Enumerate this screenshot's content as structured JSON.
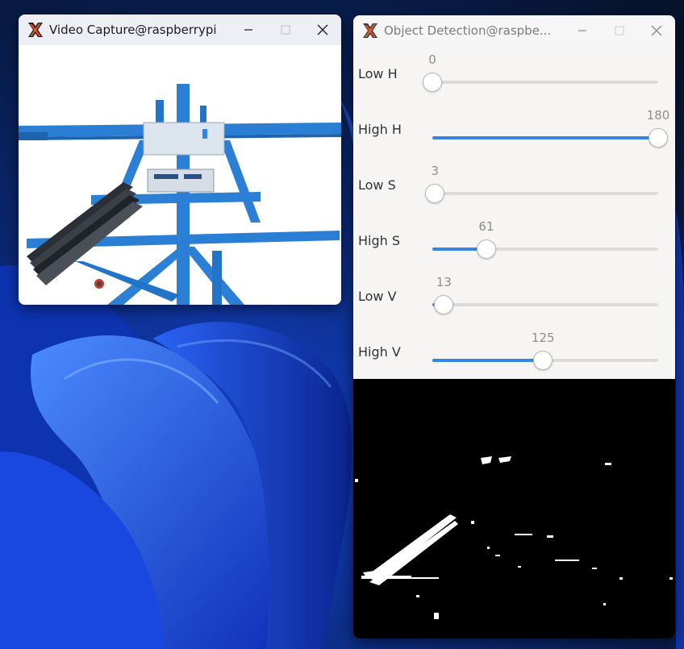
{
  "windows": {
    "capture": {
      "title": "Video Capture@raspberrypi",
      "minimize_icon": "minimize-icon",
      "maximize_icon": "maximize-icon",
      "close_icon": "close-icon"
    },
    "detection": {
      "title": "Object Detection@raspbe...",
      "minimize_icon": "minimize-icon",
      "maximize_icon": "maximize-icon",
      "close_icon": "close-icon"
    }
  },
  "trackbars": [
    {
      "label": "Low H",
      "value": "0",
      "min": 0,
      "max": 180,
      "current": 0
    },
    {
      "label": "High H",
      "value": "180",
      "min": 0,
      "max": 180,
      "current": 180
    },
    {
      "label": "Low S",
      "value": "3",
      "min": 0,
      "max": 255,
      "current": 3
    },
    {
      "label": "High S",
      "value": "61",
      "min": 0,
      "max": 255,
      "current": 61
    },
    {
      "label": "Low V",
      "value": "13",
      "min": 0,
      "max": 255,
      "current": 13
    },
    {
      "label": "High V",
      "value": "125",
      "min": 0,
      "max": 255,
      "current": 125
    }
  ],
  "colors": {
    "accent": "#3584e4",
    "frame_blue": "#2b7fd4",
    "wallpaper_blue": "#1f4fe0"
  }
}
